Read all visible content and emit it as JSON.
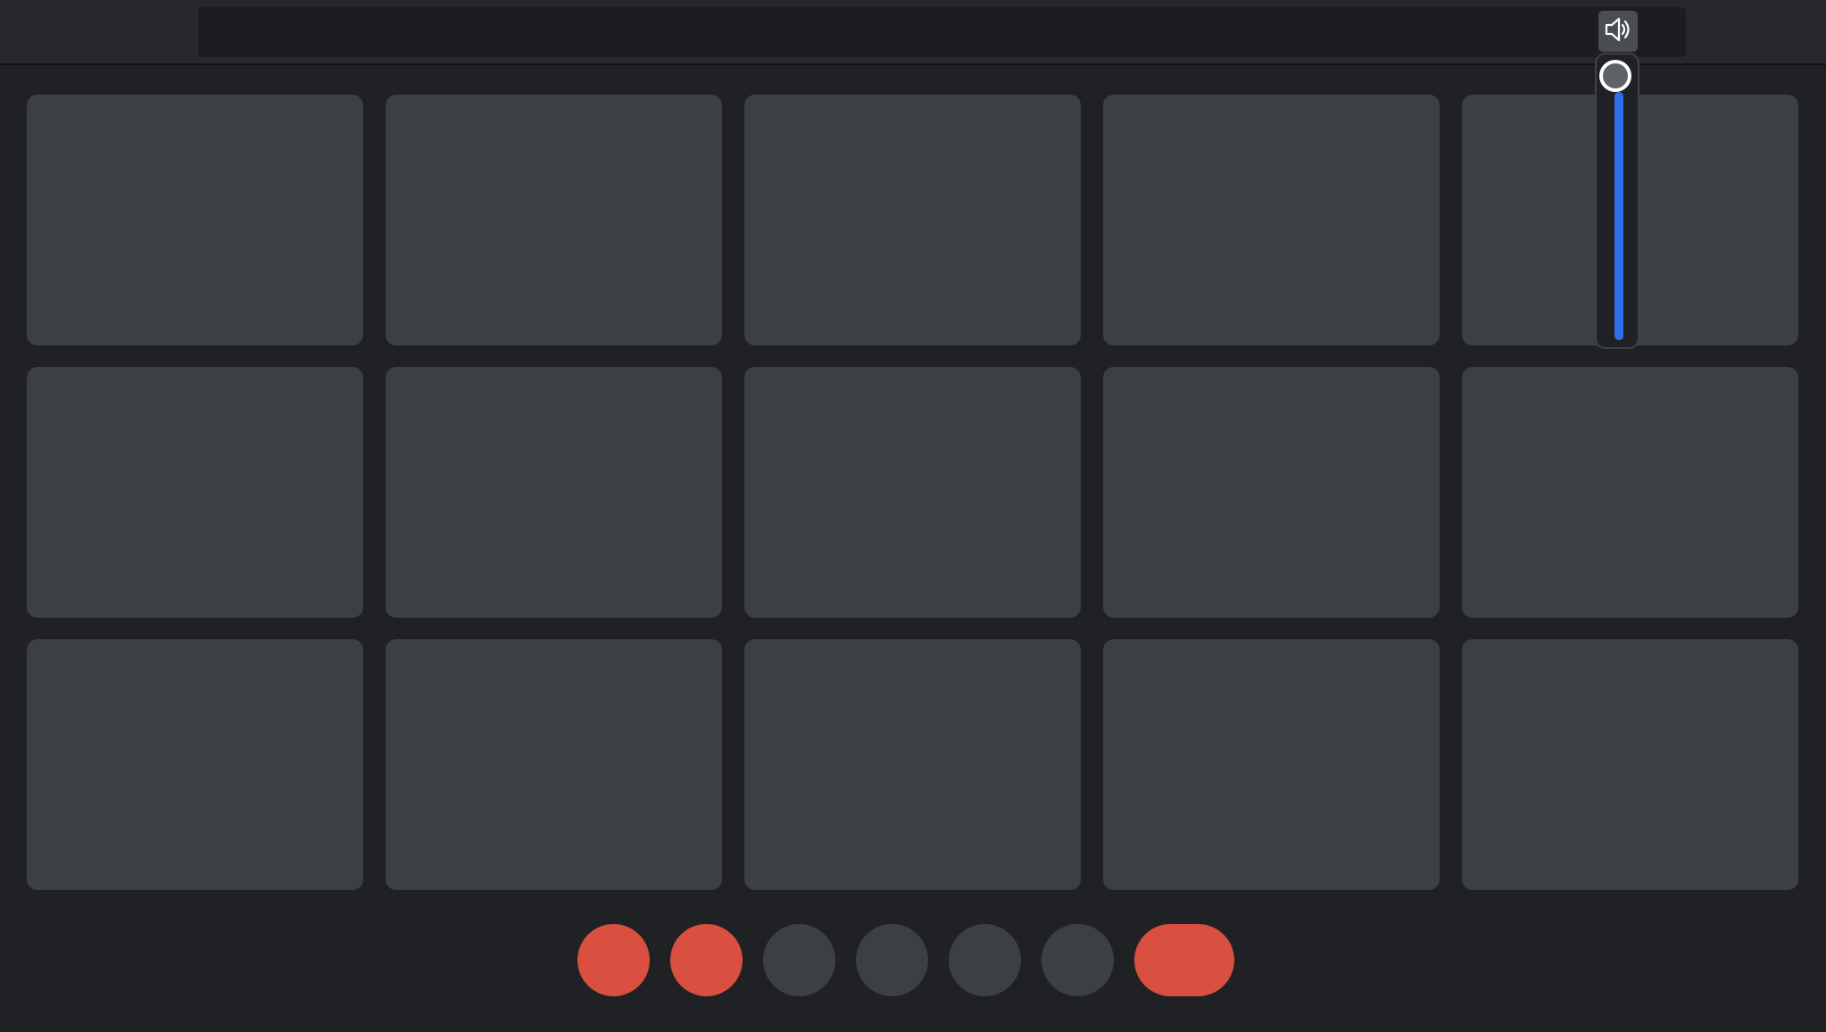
{
  "colors": {
    "background": "#202124",
    "topbar": "#27272d",
    "tile": "#3c4043",
    "accent_red": "#d94f40",
    "inactive_control": "#3c4043",
    "volume_fill": "#2f6fe8"
  },
  "toolbar": {
    "volume_icon": "speaker-volume-icon"
  },
  "volume": {
    "level_percent": 100
  },
  "tiles": [
    {},
    {},
    {},
    {},
    {},
    {},
    {},
    {},
    {},
    {},
    {},
    {},
    {},
    {},
    {}
  ],
  "controls": [
    {
      "name": "control-button-1",
      "color": "#d94f40",
      "shape": "circle"
    },
    {
      "name": "control-button-2",
      "color": "#d94f40",
      "shape": "circle"
    },
    {
      "name": "control-button-3",
      "color": "#3c4043",
      "shape": "circle"
    },
    {
      "name": "control-button-4",
      "color": "#3c4043",
      "shape": "circle"
    },
    {
      "name": "control-button-5",
      "color": "#3c4043",
      "shape": "circle"
    },
    {
      "name": "control-button-6",
      "color": "#3c4043",
      "shape": "circle"
    },
    {
      "name": "end-call-button",
      "color": "#d94f40",
      "shape": "pill"
    }
  ]
}
